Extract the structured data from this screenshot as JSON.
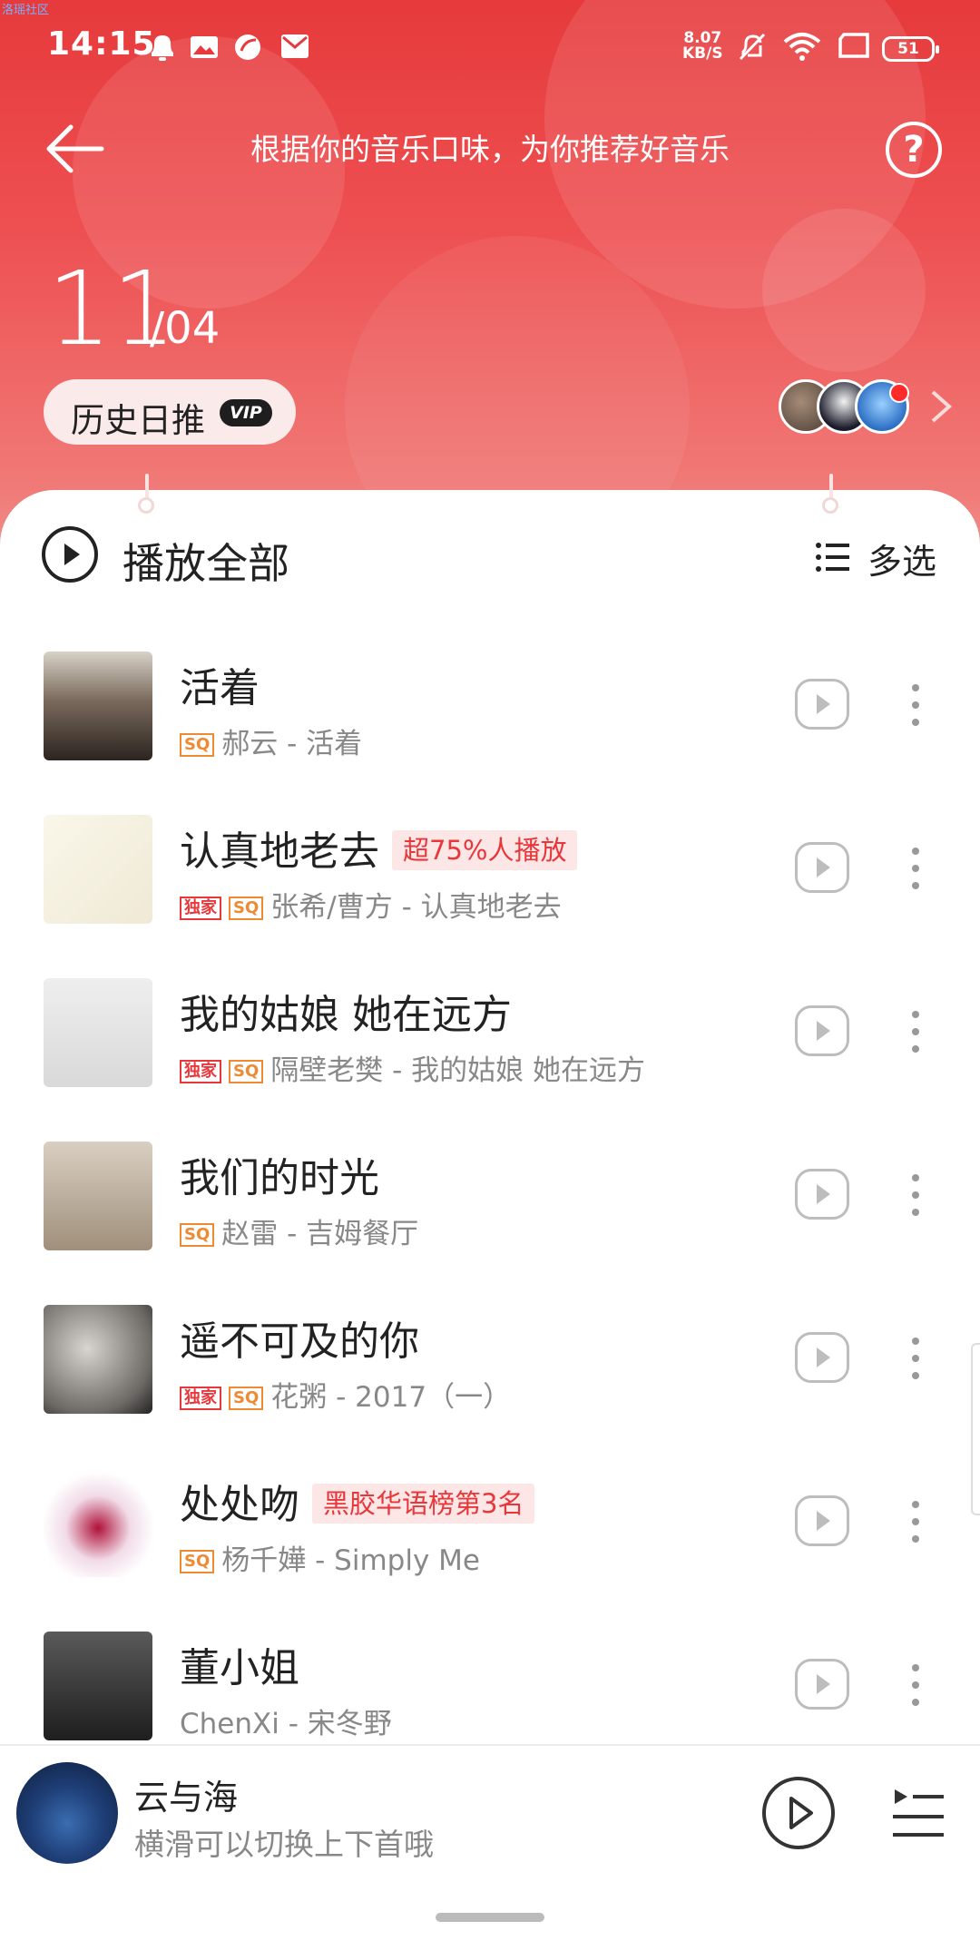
{
  "watermark": "洛瑶社区",
  "status_bar": {
    "time": "14:15",
    "net_speed_value": "8.07",
    "net_speed_unit": "KB/S",
    "battery": "51"
  },
  "header": {
    "subtitle": "根据你的音乐口味，为你推荐好音乐",
    "date_day": "11",
    "date_month": "/04",
    "history_label": "历史日推",
    "vip_label": "VIP"
  },
  "toolbar": {
    "play_all": "播放全部",
    "multi_select": "多选"
  },
  "songs": [
    {
      "title": "活着",
      "tag": "",
      "exclusive": false,
      "sq": true,
      "artist": "郝云",
      "album": "活着"
    },
    {
      "title": "认真地老去",
      "tag": "超75%人播放",
      "exclusive": true,
      "sq": true,
      "artist": "张希/曹方",
      "album": "认真地老去"
    },
    {
      "title": "我的姑娘 她在远方",
      "tag": "",
      "exclusive": true,
      "sq": true,
      "artist": "隔壁老樊",
      "album": "我的姑娘 她在远方"
    },
    {
      "title": "我们的时光",
      "tag": "",
      "exclusive": false,
      "sq": true,
      "artist": "赵雷",
      "album": "吉姆餐厅"
    },
    {
      "title": "遥不可及的你",
      "tag": "",
      "exclusive": true,
      "sq": true,
      "artist": "花粥",
      "album": "2017（一）"
    },
    {
      "title": "处处吻",
      "tag": "黑胶华语榜第3名",
      "exclusive": false,
      "sq": true,
      "artist": "杨千嬅",
      "album": "Simply Me"
    },
    {
      "title": "董小姐",
      "tag": "",
      "exclusive": false,
      "sq": false,
      "artist": "ChenXi",
      "album": "宋冬野"
    }
  ],
  "badges": {
    "exclusive": "独家",
    "sq": "SQ"
  },
  "mini_player": {
    "title": "云与海",
    "hint": "横滑可以切换上下首哦"
  },
  "colors": {
    "brand_red": "#e63a3c",
    "tag_bg": "#fde6e6",
    "sq_orange": "#ee8a32"
  }
}
